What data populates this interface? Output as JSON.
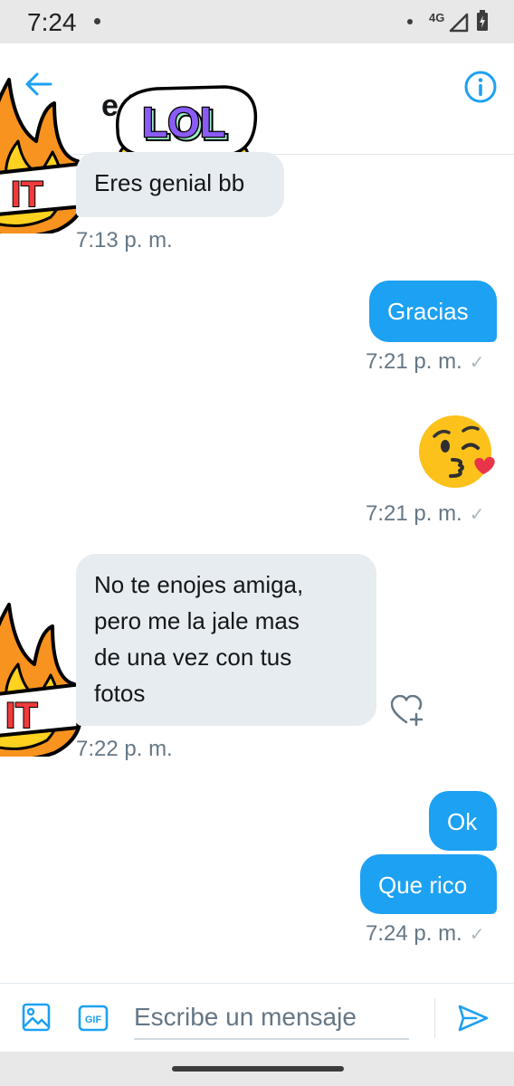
{
  "status_bar": {
    "time": "7:24",
    "network": "4G"
  },
  "header": {
    "title": "e         57",
    "sticker": "LOL"
  },
  "stickers": {
    "fire_text": "IT"
  },
  "messages": [
    {
      "direction": "incoming",
      "text": "Eres genial bb",
      "time": "7:13 p. m."
    },
    {
      "direction": "outgoing",
      "text": "Gracias",
      "time": "7:21 p. m.",
      "status": "✓"
    },
    {
      "direction": "outgoing",
      "type": "emoji",
      "emoji": "face-blowing-a-kiss",
      "time": "7:21 p. m.",
      "status": "✓"
    },
    {
      "direction": "incoming",
      "lines": [
        "No te enojes amiga,",
        "pero me la jale mas",
        "de una vez con tus",
        "fotos"
      ],
      "time": "7:22 p. m."
    },
    {
      "direction": "outgoing",
      "text": "Ok"
    },
    {
      "direction": "outgoing",
      "text": "Que rico",
      "time": "7:24 p. m.",
      "status": "✓"
    }
  ],
  "composer": {
    "placeholder": "Escribe un mensaje",
    "gif_label": "GIF"
  },
  "colors": {
    "accent": "#1da1f2",
    "incoming_bubble": "#e6ecf0",
    "timestamp": "#657786"
  }
}
